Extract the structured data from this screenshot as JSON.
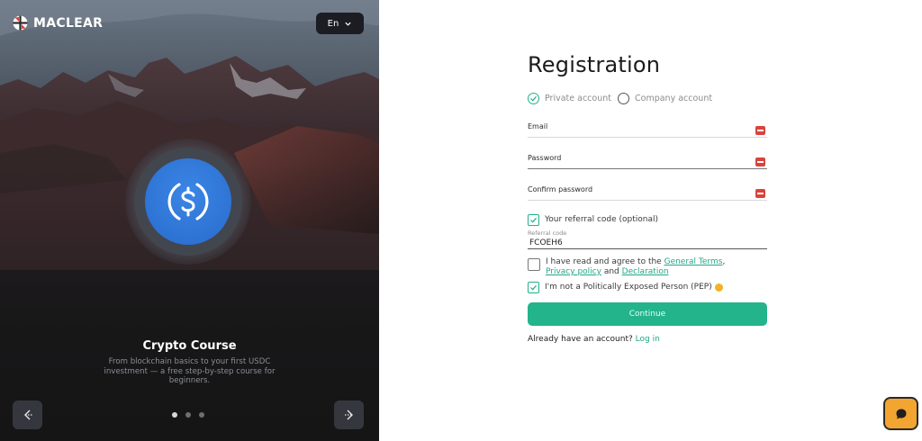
{
  "brand": {
    "name": "MACLEAR"
  },
  "language": {
    "current": "En"
  },
  "hero": {
    "title": "Crypto Course",
    "subtitle": "From blockchain basics to your first USDC investment — a free step-by-step course for beginners."
  },
  "carousel": {
    "count": 3,
    "active": 0
  },
  "form": {
    "title": "Registration",
    "account_types": [
      "Private account",
      "Company account"
    ],
    "selected_account": "Private account",
    "email_label": "Email",
    "password_label": "Password",
    "confirm_label": "Confirm password",
    "referral_toggle": "Your referral code (optional)",
    "referral_label": "Referral code",
    "referral_value": "FCOEH6",
    "terms_prefix": "I have read and agree to the",
    "terms_link": "General Terms",
    "terms_comma": ",",
    "privacy_link": "Privacy policy",
    "terms_and": "and",
    "declaration_link": "Declaration",
    "pep_text": "I'm not a Politically Exposed Person (PEP)",
    "continue_label": "Continue",
    "have_account": "Already have an account?",
    "login_link": "Log in"
  },
  "icons": {
    "logo": "maclear-logo-icon",
    "coin": "usdc-coin-icon",
    "chat": "chat-icon"
  },
  "colors": {
    "accent": "#23b48c",
    "error": "#d9433c",
    "chat": "#f3a531",
    "coin": "#2e73d4"
  }
}
